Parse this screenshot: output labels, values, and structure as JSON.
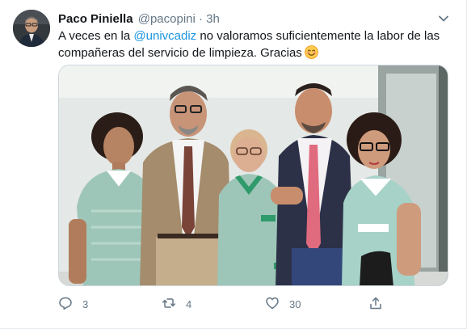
{
  "tweet": {
    "author": {
      "display_name": "Paco Piniella",
      "handle": "@pacopini",
      "separator": "·",
      "time": "3h"
    },
    "text": {
      "before_mention": "A veces en la ",
      "mention": "@univcadiz",
      "after_mention": " no valoramos suficientemente la labor de las compañeras del servicio de limpieza. Gracias",
      "emoji": "smiling-face-emoji"
    },
    "media": {
      "description_icon": "group-photo"
    },
    "actions": {
      "reply_count": "3",
      "retweet_count": "4",
      "like_count": "30"
    }
  },
  "icons": {
    "menu": "chevron-down-icon",
    "reply": "reply-icon",
    "retweet": "retweet-icon",
    "like": "heart-icon",
    "share": "share-icon"
  },
  "colors": {
    "text_primary": "#14171a",
    "text_secondary": "#657786",
    "link": "#1b95e0",
    "border": "#e6ecf0"
  }
}
